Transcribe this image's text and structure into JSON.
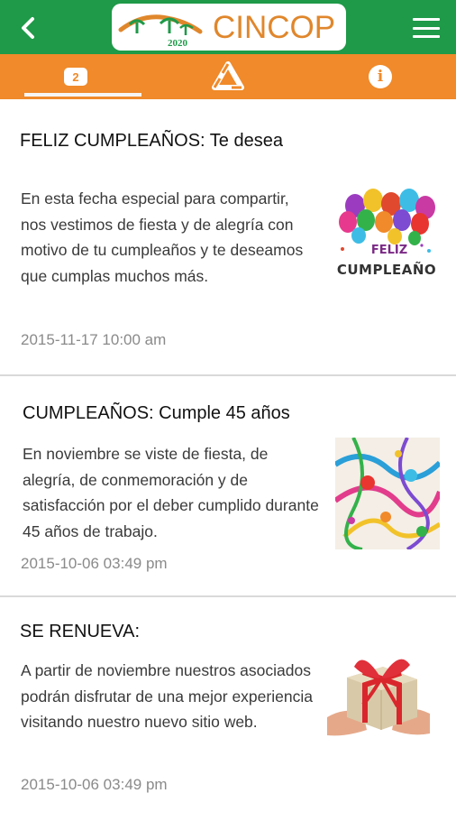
{
  "appbar": {
    "logo_text": "CINCOP",
    "logo_year": "2020",
    "back_icon": "chevron-left-icon",
    "menu_icon": "hamburger-menu-icon",
    "bar_color": "#1e9a48",
    "logo_color": "#e0872c"
  },
  "tabs": [
    {
      "name": "notifications",
      "badge": "2",
      "icon": "badge-icon",
      "active": true
    },
    {
      "name": "home",
      "icon": "recycle-triangle-icon",
      "active": false
    },
    {
      "name": "info",
      "icon": "info-icon",
      "label": "i",
      "active": false
    }
  ],
  "tab_color": "#f08a2a",
  "posts": [
    {
      "title": "FELIZ CUMPLEAÑOS: Te desea",
      "body": "En esta fecha especial para compartir, nos vestimos de fiesta y de alegría con motivo de tu cumpleaños y te deseamos que cumplas muchos más.",
      "date": "2015-11-17 10:00 am",
      "image": "balloons-birthday-image",
      "image_caption_top": "FELIZ",
      "image_caption": "CUMPLEAÑO"
    },
    {
      "title": "CUMPLEAÑOS:  Cumple 45 años",
      "body": "En noviembre  se viste de fiesta, de alegría, de conmemoración y de satisfacción por el deber cumplido durante 45 años de trabajo.",
      "date": "2015-10-06 03:49 pm",
      "image": "party-streamers-image"
    },
    {
      "title": "SE RENUEVA:",
      "body": "A partir de noviembre nuestros asociados podrán disfrutar de una mejor experiencia visitando nuestro nuevo sitio web.",
      "date": "2015-10-06 03:49 pm",
      "image": "gift-box-image"
    }
  ]
}
